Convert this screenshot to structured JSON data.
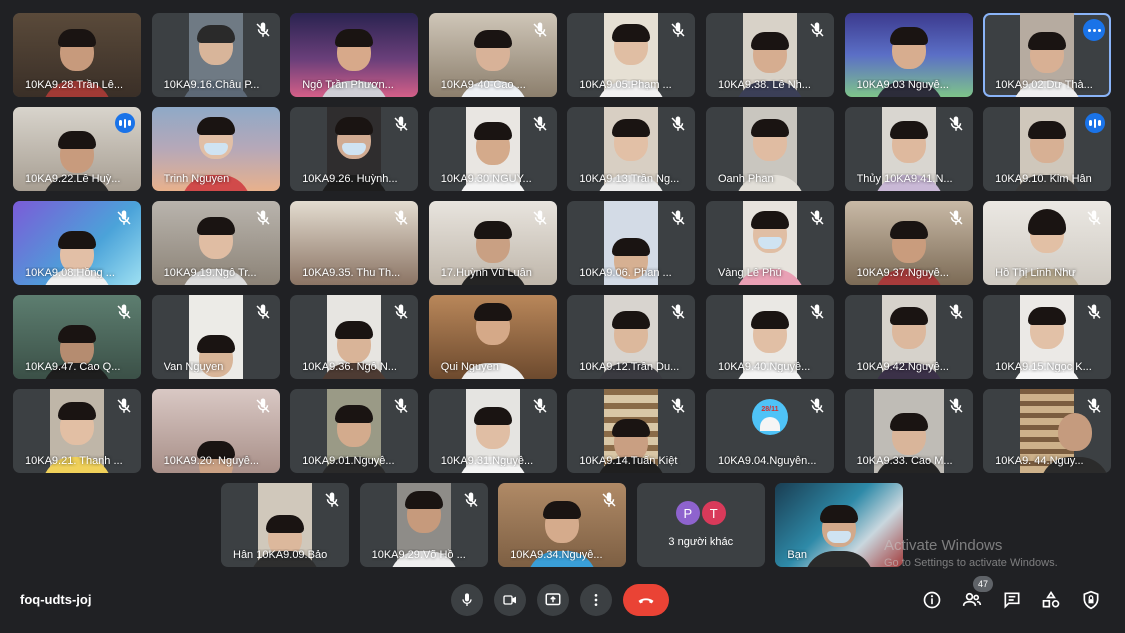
{
  "tiles": [
    {
      "name": "10KA9.28.Trần Lê..."
    },
    {
      "name": "10KA9.16.Châu P..."
    },
    {
      "name": "Ngô Trần Phươn..."
    },
    {
      "name": "10KA9-40-Cao ..."
    },
    {
      "name": "10KA9.05.Phạm ..."
    },
    {
      "name": "10KA9.38. Lê Nh..."
    },
    {
      "name": "10KA9.03 Nguyễ..."
    },
    {
      "name": "10KA9.02.Dư Thà..."
    },
    {
      "name": "10KA9.22.Lê Huỳ..."
    },
    {
      "name": "Trinh Nguyen"
    },
    {
      "name": "10KA9.26. Huỳnh..."
    },
    {
      "name": "10KA9.30.NGUY..."
    },
    {
      "name": "10KA9.13.Trần Ng..."
    },
    {
      "name": "Oanh Phan"
    },
    {
      "name": "Thủy 10KA9.41.N..."
    },
    {
      "name": "10KA9.10. Kim Hân"
    },
    {
      "name": "10KA9.08.Hồng ..."
    },
    {
      "name": "10KA9.19.Ngô Tr..."
    },
    {
      "name": "10KA9.35. Thu Th..."
    },
    {
      "name": "17.Huỳnh Vũ Luân"
    },
    {
      "name": "10KA9.06. Phan ..."
    },
    {
      "name": "Vàng Lê Phú"
    },
    {
      "name": "10KA9.37.Nguyễ..."
    },
    {
      "name": "Hồ Thị Linh Như"
    },
    {
      "name": "10KA9.47. Cao Q..."
    },
    {
      "name": "Van Nguyen"
    },
    {
      "name": "10KA9.36. Ngô N..."
    },
    {
      "name": "Qui Nguyen"
    },
    {
      "name": "10KA9.12.Trần Du..."
    },
    {
      "name": "10KA9.40.Nguyễ..."
    },
    {
      "name": "10KA9.42.Nguyễ..."
    },
    {
      "name": "10KA9.15.Ngọc K..."
    },
    {
      "name": "10KA9.21. Thanh ..."
    },
    {
      "name": "10KA9.20. Nguyễ..."
    },
    {
      "name": "10KA9.01.Nguyễ..."
    },
    {
      "name": "10KA9.31.Nguyễ..."
    },
    {
      "name": "10KA9.14.Tuấn Kiệt"
    },
    {
      "name": "10KA9.04.Nguyễn..."
    },
    {
      "name": "10KA9.33. Cao M..."
    },
    {
      "name": "10KA9. 44.Nguy..."
    },
    {
      "name": "Hân 10KA9.09.Bảo"
    },
    {
      "name": "10KA9.29.Võ Hồ ..."
    },
    {
      "name": "10KA9.34.Nguyễ..."
    },
    {
      "name": "Bạn"
    }
  ],
  "avatar_text": "28/11",
  "others": {
    "label": "3 người khác",
    "initials": [
      "P",
      "T"
    ],
    "colors": [
      "#8e63ce",
      "#d93a5a"
    ]
  },
  "meeting_code": "foq-udts-joj",
  "participants_count": "47",
  "watermark": {
    "line1": "Activate Windows",
    "line2": "Go to Settings to activate Windows."
  },
  "colors": {
    "background": "#202124",
    "tile": "#3c4043",
    "hangup": "#ea4335",
    "accent": "#1a73e8",
    "active_outline": "#8ab4f8"
  }
}
